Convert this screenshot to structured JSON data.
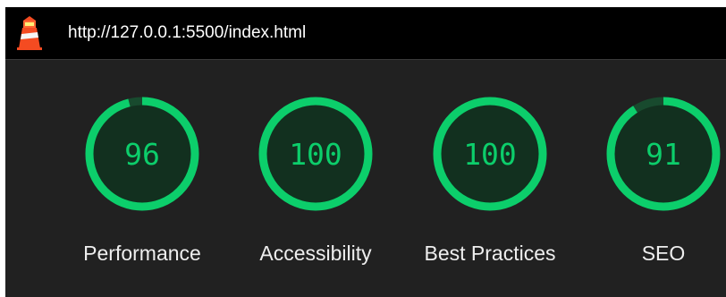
{
  "header": {
    "url": "http://127.0.0.1:5500/index.html",
    "logo_icon": "lighthouse-icon"
  },
  "colors": {
    "pass": "#0cce6b",
    "pass_fill": "#12301f",
    "track": "#184a2e",
    "background": "#212121",
    "topbar": "#000000"
  },
  "gauges": [
    {
      "score": 96,
      "label": "Performance"
    },
    {
      "score": 100,
      "label": "Accessibility"
    },
    {
      "score": 100,
      "label": "Best Practices"
    },
    {
      "score": 91,
      "label": "SEO"
    }
  ]
}
